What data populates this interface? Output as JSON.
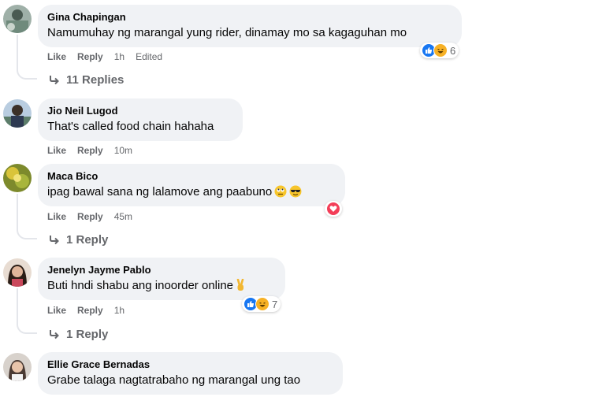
{
  "actions": {
    "like": "Like",
    "reply": "Reply",
    "edited": "Edited"
  },
  "comments": [
    {
      "name": "Gina Chapingan",
      "text": "Namumuhay ng marangal yung rider, dinamay mo sa kagaguhan mo",
      "time": "1h",
      "edited": true,
      "reactions": [
        "like",
        "haha"
      ],
      "reaction_count": "6",
      "replies": "11 Replies"
    },
    {
      "name": "Jio Neil Lugod",
      "text": "That's called food chain hahaha",
      "time": "10m"
    },
    {
      "name": "Maca Bico",
      "text": "ipag bawal sana ng lalamove ang paabuno",
      "emojis": [
        "rolling-eyes-emoji",
        "sunglasses-emoji"
      ],
      "time": "45m",
      "reactions": [
        "love"
      ],
      "replies": "1 Reply"
    },
    {
      "name": "Jenelyn Jayme Pablo",
      "text": "Buti hndi shabu ang inoorder online",
      "emojis": [
        "victory-hand-emoji"
      ],
      "time": "1h",
      "reactions": [
        "like",
        "haha"
      ],
      "reaction_count": "7",
      "replies": "1 Reply"
    },
    {
      "name": "Ellie Grace Bernadas",
      "text": "Grabe talaga nagtatrabaho ng marangal ung tao"
    }
  ],
  "colors": {
    "bubble": "#f0f2f5",
    "meta": "#65676b",
    "like": "#1877f2",
    "haha": "#f7b125",
    "love": "#f33e58"
  }
}
